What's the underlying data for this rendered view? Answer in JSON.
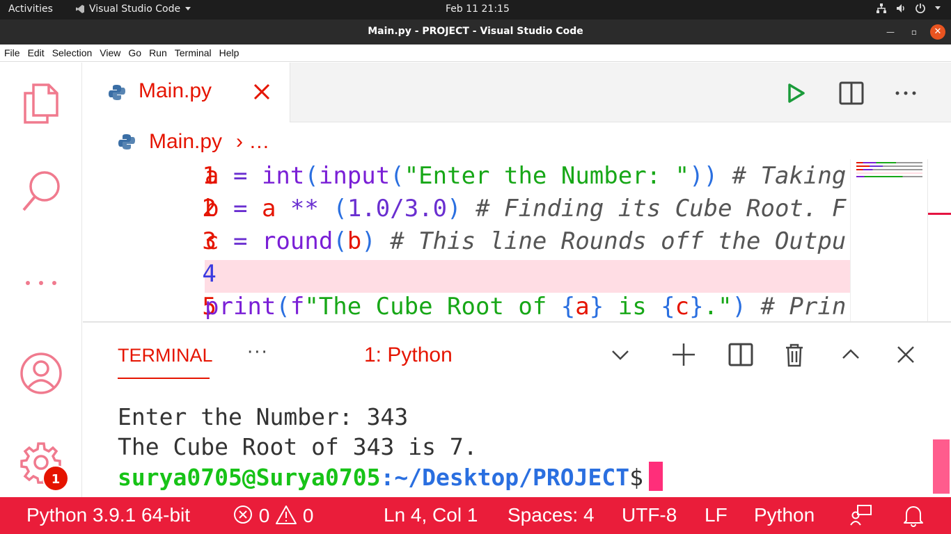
{
  "system_bar": {
    "activities": "Activities",
    "app_name": "Visual Studio Code",
    "clock": "Feb 11  21:15"
  },
  "window": {
    "title": "Main.py - PROJECT - Visual Studio Code"
  },
  "menu": [
    "File",
    "Edit",
    "Selection",
    "View",
    "Go",
    "Run",
    "Terminal",
    "Help"
  ],
  "editor": {
    "tab_label": "Main.py",
    "breadcrumb_file": "Main.py",
    "breadcrumb_rest": "…",
    "line_numbers": [
      "1",
      "2",
      "3",
      "4",
      "5"
    ],
    "current_line": 4,
    "lines": [
      "a = int(input(\"Enter the Number: \")) # Taking",
      "b = a ** (1.0/3.0) # Finding its Cube Root. F",
      "c = round(b) # This line Rounds off the Outpu",
      "",
      "print(f\"The Cube Root of {a} is {c}.\") # Prin"
    ]
  },
  "panel": {
    "tab_label": "TERMINAL",
    "more_label": "···",
    "terminal_select": "1: Python",
    "output": [
      "Enter the Number: 343",
      "The Cube Root of 343 is 7."
    ],
    "prompt_user": "surya0705@Surya0705",
    "prompt_path": ":~/Desktop/PROJECT",
    "prompt_symbol": "$"
  },
  "activity_badge": "1",
  "status": {
    "interpreter": "Python 3.9.1 64-bit",
    "errors": "0",
    "warnings": "0",
    "position": "Ln 4, Col 1",
    "spaces": "Spaces: 4",
    "encoding": "UTF-8",
    "eol": "LF",
    "language": "Python"
  },
  "colors": {
    "accent": "#e51400",
    "status_bar": "#ea1d3a",
    "current_line_bg": "#ffdde4"
  }
}
